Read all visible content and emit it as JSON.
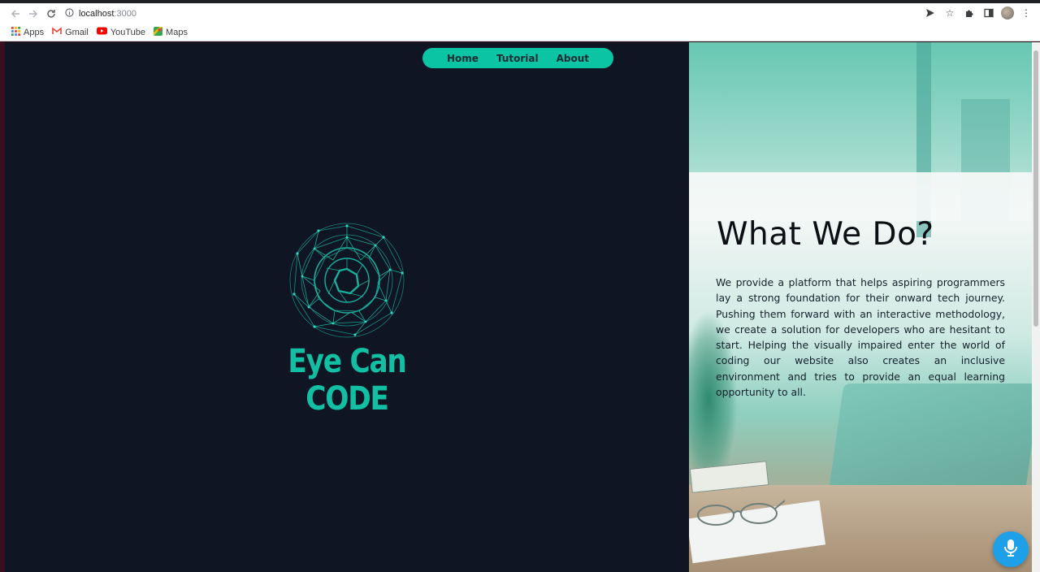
{
  "browser": {
    "url_host": "localhost",
    "url_port": ":3000",
    "bookmarks": [
      {
        "label": "Apps",
        "icon": "apps-grid-icon"
      },
      {
        "label": "Gmail",
        "icon": "gmail-icon"
      },
      {
        "label": "YouTube",
        "icon": "youtube-icon"
      },
      {
        "label": "Maps",
        "icon": "maps-icon"
      }
    ]
  },
  "nav": {
    "items": [
      {
        "label": "Home"
      },
      {
        "label": "Tutorial"
      },
      {
        "label": "About"
      }
    ]
  },
  "hero": {
    "brand": "Eye Can CODE",
    "logo_icon": "eye-wireframe-logo"
  },
  "about": {
    "heading": "What We Do?",
    "paragraph": "We provide a platform that helps aspiring programmers lay a strong foundation for their onward tech journey. Pushing them forward with an interactive methodology, we create a solution for developers who are hesitant to start. Helping the visually impaired enter the world of coding our website also creates an inclusive environment and tries to provide an equal learning opportunity to all."
  },
  "colors": {
    "accent": "#0bc4a4",
    "dark_bg": "#0f1523",
    "mic": "#1ea0e8"
  }
}
